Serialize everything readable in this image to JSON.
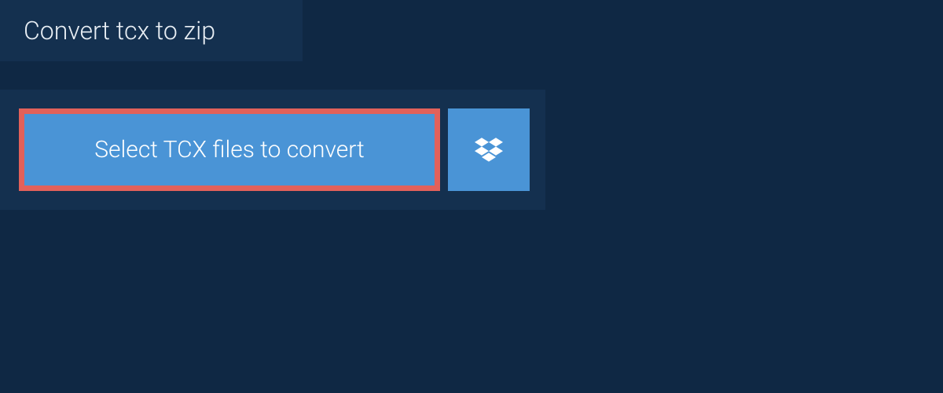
{
  "header": {
    "title": "Convert tcx to zip"
  },
  "upload": {
    "select_label": "Select TCX files to convert",
    "dropbox_icon": "dropbox-icon"
  },
  "colors": {
    "page_bg": "#0f2844",
    "panel_bg": "#14304f",
    "button_bg": "#4a94d6",
    "highlight_border": "#e2615a",
    "text_light": "#e8eef4",
    "text_white": "#ffffff"
  }
}
